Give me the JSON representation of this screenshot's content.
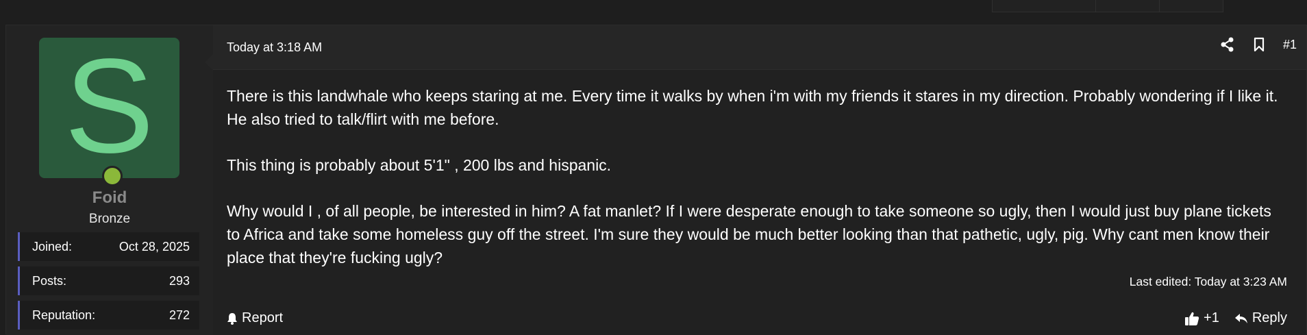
{
  "user": {
    "avatar_letter": "S",
    "name": "Foid",
    "title": "Bronze",
    "stats": [
      {
        "label": "Joined:",
        "value": "Oct 28, 2025"
      },
      {
        "label": "Posts:",
        "value": "293"
      },
      {
        "label": "Reputation:",
        "value": "272"
      }
    ]
  },
  "post": {
    "date": "Today at 3:18 AM",
    "number": "#1",
    "paragraphs": [
      "There is this landwhale who keeps staring at me. Every time it walks by when i'm with my friends it stares in my direction. Probably wondering if I like it. He also tried to talk/flirt with me before.",
      "This thing is probably about 5'1\" , 200 lbs and hispanic.",
      "Why would I , of all people, be interested in him? A fat manlet? If I were desperate enough to take someone so ugly, then I would just buy plane tickets to Africa and take some homeless guy off the street. I'm sure they would be much better looking than that pathetic, ugly, pig. Why cant men know their place that they're fucking ugly?"
    ],
    "last_edited": "Last edited: Today at 3:23 AM"
  },
  "actions": {
    "report_label": "Report",
    "like_label": "+1",
    "reply_label": "Reply"
  },
  "icons": {
    "share": "share-icon",
    "bookmark": "bookmark-icon",
    "bell": "bell-icon",
    "thumbs_up": "thumbs-up-icon",
    "reply": "reply-icon"
  },
  "colors": {
    "avatar_bg": "#2a5a3c",
    "avatar_letter": "#6fd18e",
    "online": "#8bb83a",
    "stat_accent": "#5a5ec0"
  }
}
